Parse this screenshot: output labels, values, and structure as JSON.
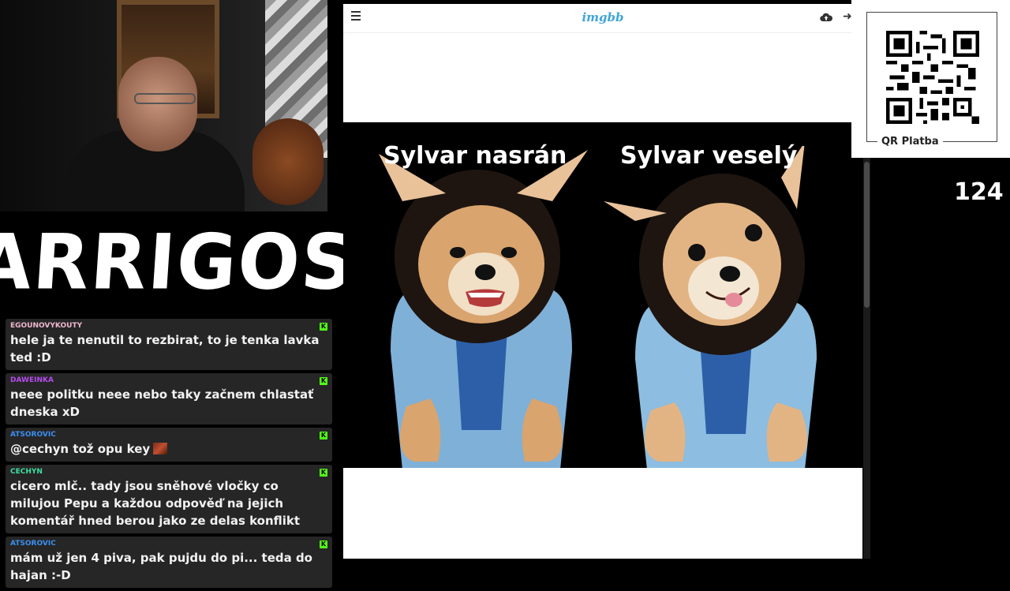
{
  "logo": {
    "text": "ARRIGOS"
  },
  "chat": {
    "messages": [
      {
        "user": "EGOUNOVYKOUTY",
        "color": "#f0b8d0",
        "text": "hele ja te nenutil to rezbirat, to je tenka lavka ted :D"
      },
      {
        "user": "DAWEINKA",
        "color": "#b54cf0",
        "text": "neee politku neee nebo taky začnem chlastať dneska xD"
      },
      {
        "user": "ATSOROVIC",
        "color": "#3b8ff0",
        "text": "@cechyn tož opu key"
      },
      {
        "user": "CECHYN",
        "color": "#3ce0a0",
        "text": "cicero mlč.. tady jsou sněhové vločky co milujou Pepu a každou odpověď na jejich komentář hned berou jako ze delas konflikt"
      },
      {
        "user": "ATSOROVIC",
        "color": "#3b8ff0",
        "text": "mám už jen 4 piva, pak pujdu do pi... teda do hajan :-D"
      }
    ]
  },
  "browser": {
    "brand": "imgbb",
    "captions": {
      "left": "Sylvar nasrán",
      "right": "Sylvar veselý"
    }
  },
  "qr": {
    "label": "QR Platba"
  },
  "counter": "124",
  "icons": {
    "menu": "hamburger-menu-icon",
    "upload": "cloud-upload-icon",
    "signin": "sign-in-arrow-icon",
    "platform": "kick-icon"
  }
}
